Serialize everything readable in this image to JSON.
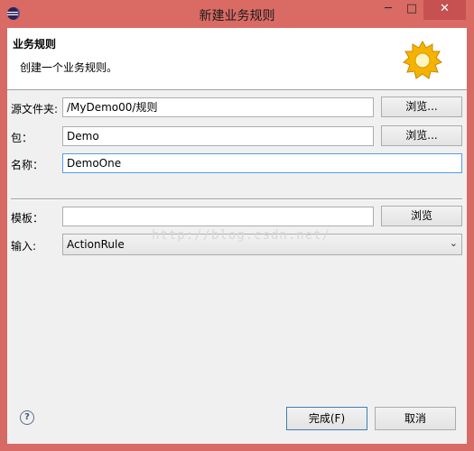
{
  "window": {
    "title": "新建业务规则",
    "min_label": "─",
    "max_label": "□",
    "close_label": "✕"
  },
  "banner": {
    "title": "业务规则",
    "description": "创建一个业务规则。"
  },
  "form": {
    "source_folder": {
      "label": "源文件夹:",
      "value": "/MyDemo00/规则",
      "browse_label": "浏览..."
    },
    "package": {
      "label": "包：",
      "value": "Demo",
      "browse_label": "浏览..."
    },
    "name": {
      "label": "名称：",
      "value": "DemoOne"
    },
    "template": {
      "label": "模板：",
      "value": "",
      "browse_label": "浏览"
    },
    "input": {
      "label": "输入:",
      "selected": "ActionRule"
    }
  },
  "watermark": "http://blog.csdn.net/",
  "footer": {
    "help_label": "?",
    "finish_label": "完成(F)",
    "cancel_label": "取消"
  }
}
